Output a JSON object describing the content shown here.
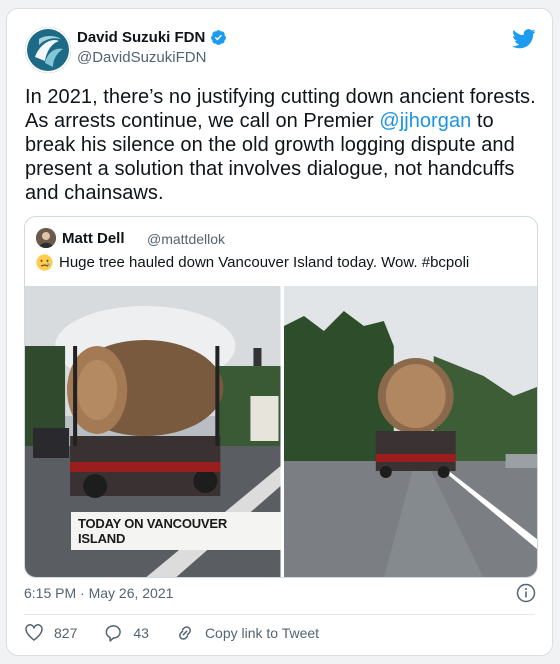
{
  "author": {
    "display_name": "David Suzuki FDN",
    "handle": "@DavidSuzukiFDN"
  },
  "tweet": {
    "text_before": "In 2021, there’s no justifying cutting down ancient forests. As arrests continue, we call on Premier ",
    "mention": "@jjhorgan",
    "text_after": " to break his silence on the old growth logging dispute and present a solution that involves dialogue, not handcuffs and chainsaws."
  },
  "quote": {
    "display_name": "Matt Dell",
    "handle": "@mattdellok",
    "text": "Huge tree hauled down Vancouver Island today. Wow. #bcpoli",
    "image_caption": "TODAY ON VANCOUVER ISLAND"
  },
  "meta": {
    "timestamp": "6:15 PM · May 26, 2021"
  },
  "actions": {
    "likes": "827",
    "replies": "43",
    "copy_link": "Copy link to Tweet"
  },
  "colors": {
    "twitter_blue": "#1d9bf0",
    "mention": "#1b95e0",
    "secondary_text": "#536471"
  }
}
